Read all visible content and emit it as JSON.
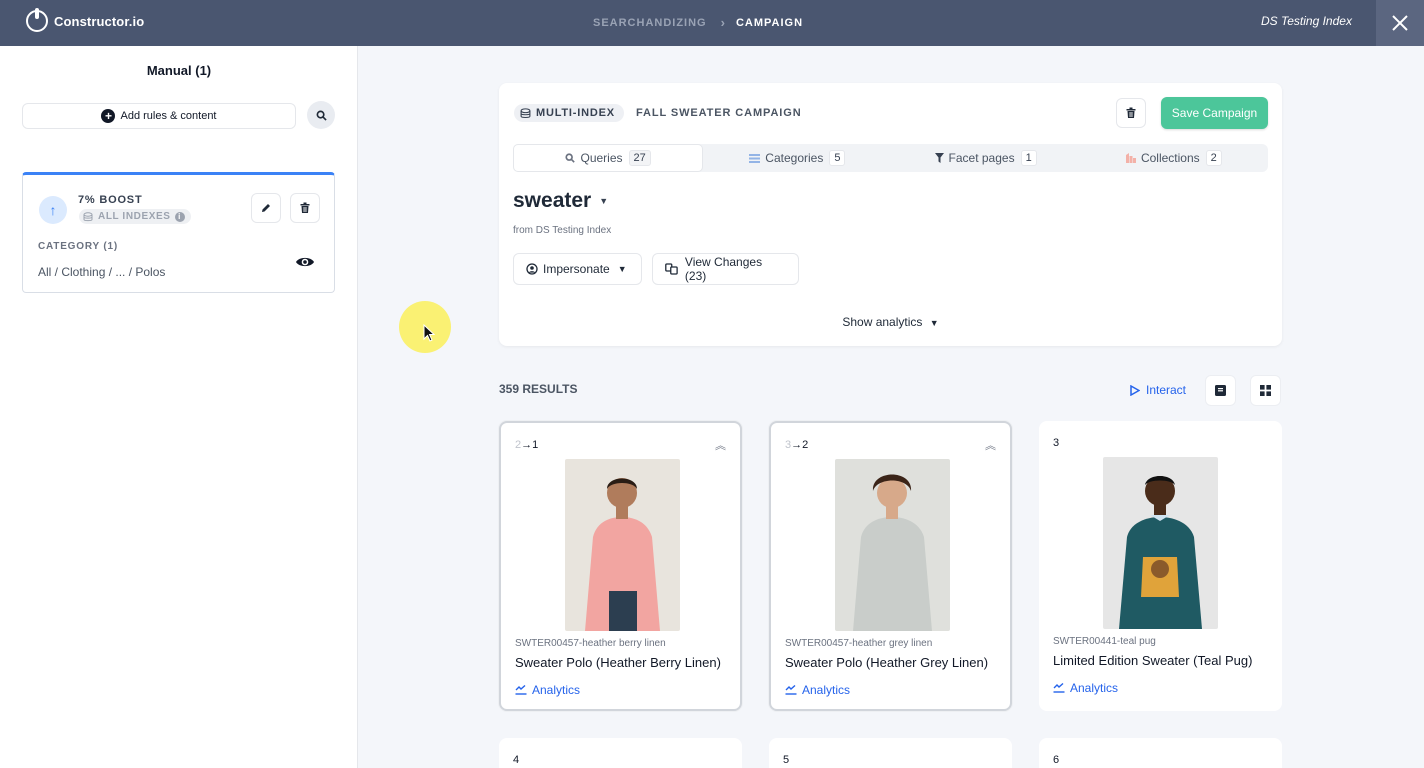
{
  "topbar": {
    "brand": "Constructor.io",
    "breadcrumb": [
      "SEARCHANDIZING",
      "CAMPAIGN"
    ],
    "index_name": "DS Testing Index",
    "close_icon": "close-icon"
  },
  "left_panel": {
    "title": "Manual (1)",
    "add_rules_label": "Add rules & content",
    "rule": {
      "title": "7% BOOST",
      "tag": "ALL INDEXES",
      "category_label": "CATEGORY (1)",
      "category_path": "All / Clothing / ... / Polos"
    }
  },
  "campaign": {
    "index_tag": "MULTI-INDEX",
    "name": "FALL SWEATER CAMPAIGN",
    "save_label": "Save Campaign",
    "tabs": [
      {
        "label": "Queries",
        "count": "27",
        "icon": "search-icon"
      },
      {
        "label": "Categories",
        "count": "5",
        "icon": "list-icon"
      },
      {
        "label": "Facet pages",
        "count": "1",
        "icon": "filter-icon"
      },
      {
        "label": "Collections",
        "count": "2",
        "icon": "collection-icon"
      }
    ],
    "query": "sweater",
    "from_index": "from DS Testing Index",
    "impersonate_label": "Impersonate",
    "view_changes_label": "View Changes (23)",
    "show_analytics_label": "Show analytics"
  },
  "results": {
    "count_label": "359 RESULTS",
    "interact_label": "Interact",
    "products": [
      {
        "old_pos": "2",
        "new_pos": "1",
        "sku": "SWTER00457-heather berry linen",
        "name": "Sweater Polo (Heather Berry Linen)",
        "analytics": "Analytics",
        "shirt_color": "#f2a5a1"
      },
      {
        "old_pos": "3",
        "new_pos": "2",
        "sku": "SWTER00457-heather grey linen",
        "name": "Sweater Polo (Heather Grey Linen)",
        "analytics": "Analytics",
        "shirt_color": "#c9cdca"
      },
      {
        "old_pos": "",
        "new_pos": "3",
        "sku": "SWTER00441-teal pug",
        "name": "Limited Edition Sweater (Teal Pug)",
        "analytics": "Analytics",
        "shirt_color": "#1f5a63"
      }
    ],
    "more_positions": [
      "4",
      "5",
      "6"
    ]
  },
  "colors": {
    "topbar": "#4a5670",
    "save_button": "#4cc69a",
    "link": "#2563eb",
    "rule_accent": "#3b82f6"
  }
}
